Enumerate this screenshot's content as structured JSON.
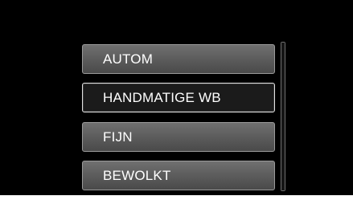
{
  "menu": {
    "items": [
      {
        "label": "AUTOM",
        "selected": false
      },
      {
        "label": "HANDMATIGE WB",
        "selected": true
      },
      {
        "label": "FIJN",
        "selected": false
      },
      {
        "label": "BEWOLKT",
        "selected": false
      }
    ]
  },
  "colors": {
    "screen_background": "#000000",
    "item_background": "#5a5a5a",
    "item_border": "#9a9a9a",
    "selected_background": "#1b1b1b",
    "selected_border": "#e2e2e2",
    "text": "#ffffff"
  }
}
